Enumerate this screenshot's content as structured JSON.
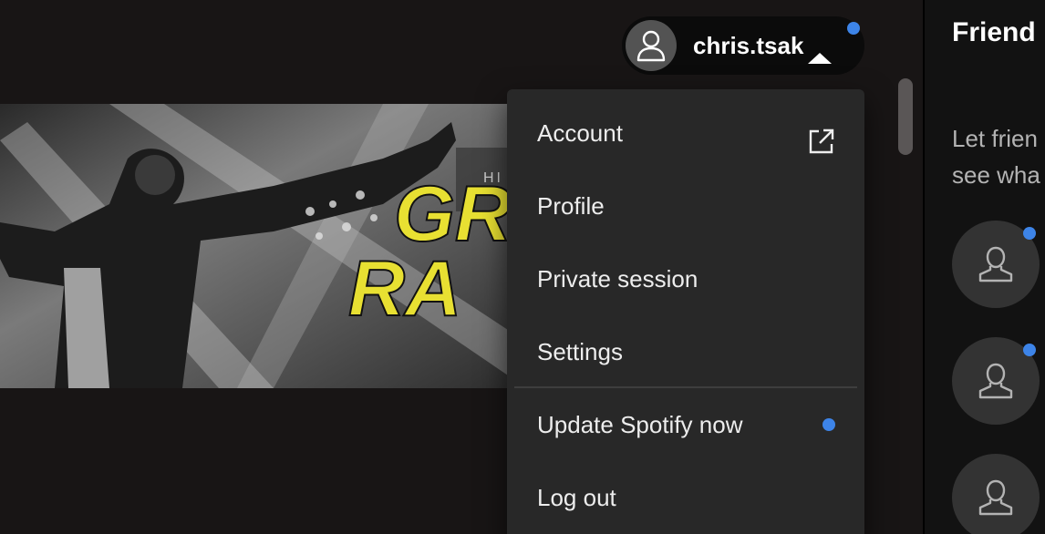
{
  "user": {
    "name": "chris.tsak",
    "avatar_icon": "user-icon",
    "menu_open_icon": "caret-up-icon",
    "has_notification": true
  },
  "menu": {
    "items": [
      {
        "label": "Account",
        "icon": "external-link-icon"
      },
      {
        "label": "Profile"
      },
      {
        "label": "Private session"
      },
      {
        "label": "Settings"
      },
      {
        "label": "Update Spotify now",
        "indicator": "notification-dot"
      },
      {
        "label": "Log out"
      }
    ]
  },
  "banner": {
    "small_text": "HI",
    "headline_line1": "GR",
    "headline_line2": "RA"
  },
  "friends": {
    "title": "Friend",
    "text_line1": "Let frien",
    "text_line2": "see wha",
    "avatar_icon": "user-icon"
  },
  "colors": {
    "accent_dot": "#3d84e8",
    "menu_bg": "#282828",
    "headline": "#e8e032"
  }
}
